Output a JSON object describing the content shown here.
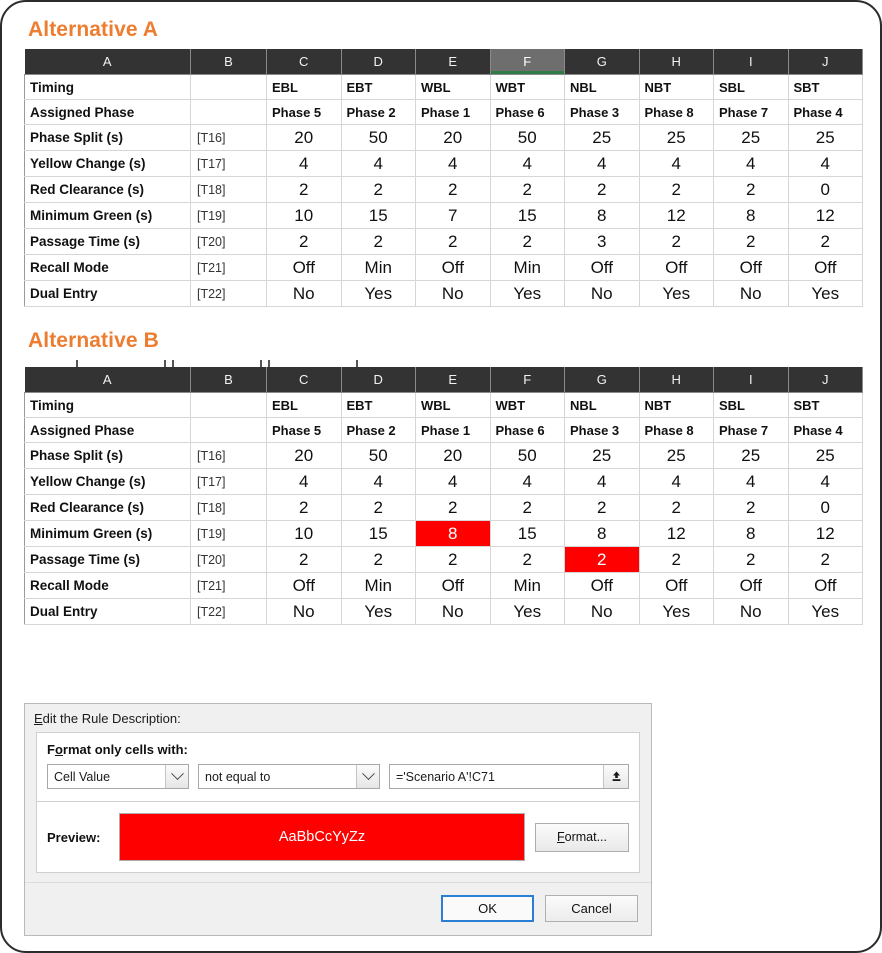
{
  "sections": [
    {
      "title": "Alternative A",
      "columns": [
        "A",
        "B",
        "C",
        "D",
        "E",
        "F",
        "G",
        "H",
        "I",
        "J"
      ],
      "active_column": "F",
      "has_tab_notches": false,
      "header_rows": [
        {
          "label": "Timing",
          "ref": "",
          "values": [
            "EBL",
            "EBT",
            "WBL",
            "WBT",
            "NBL",
            "NBT",
            "SBL",
            "SBT"
          ]
        },
        {
          "label": "Assigned Phase",
          "ref": "",
          "values": [
            "Phase 5",
            "Phase 2",
            "Phase 1",
            "Phase 6",
            "Phase 3",
            "Phase 8",
            "Phase 7",
            "Phase 4"
          ]
        }
      ],
      "rows": [
        {
          "label": "Phase Split (s)",
          "ref": "[T16]",
          "values": [
            "20",
            "50",
            "20",
            "50",
            "25",
            "25",
            "25",
            "25"
          ],
          "flags": [
            false,
            false,
            false,
            false,
            false,
            false,
            false,
            false
          ]
        },
        {
          "label": "Yellow Change (s)",
          "ref": "[T17]",
          "values": [
            "4",
            "4",
            "4",
            "4",
            "4",
            "4",
            "4",
            "4"
          ],
          "flags": [
            false,
            false,
            false,
            false,
            false,
            false,
            false,
            false
          ]
        },
        {
          "label": "Red Clearance (s)",
          "ref": "[T18]",
          "values": [
            "2",
            "2",
            "2",
            "2",
            "2",
            "2",
            "2",
            "0"
          ],
          "flags": [
            false,
            false,
            false,
            false,
            false,
            false,
            false,
            false
          ]
        },
        {
          "label": "Minimum Green (s)",
          "ref": "[T19]",
          "values": [
            "10",
            "15",
            "7",
            "15",
            "8",
            "12",
            "8",
            "12"
          ],
          "flags": [
            false,
            false,
            false,
            false,
            false,
            false,
            false,
            false
          ]
        },
        {
          "label": "Passage Time (s)",
          "ref": "[T20]",
          "values": [
            "2",
            "2",
            "2",
            "2",
            "3",
            "2",
            "2",
            "2"
          ],
          "flags": [
            false,
            false,
            false,
            false,
            false,
            false,
            false,
            false
          ]
        },
        {
          "label": "Recall Mode",
          "ref": "[T21]",
          "values": [
            "Off",
            "Min",
            "Off",
            "Min",
            "Off",
            "Off",
            "Off",
            "Off"
          ],
          "flags": [
            false,
            false,
            false,
            false,
            false,
            false,
            false,
            false
          ]
        },
        {
          "label": "Dual Entry",
          "ref": "[T22]",
          "values": [
            "No",
            "Yes",
            "No",
            "Yes",
            "No",
            "Yes",
            "No",
            "Yes"
          ],
          "flags": [
            false,
            false,
            false,
            false,
            false,
            false,
            false,
            false
          ]
        }
      ]
    },
    {
      "title": "Alternative B",
      "columns": [
        "A",
        "B",
        "C",
        "D",
        "E",
        "F",
        "G",
        "H",
        "I",
        "J"
      ],
      "active_column": "",
      "has_tab_notches": true,
      "header_rows": [
        {
          "label": "Timing",
          "ref": "",
          "values": [
            "EBL",
            "EBT",
            "WBL",
            "WBT",
            "NBL",
            "NBT",
            "SBL",
            "SBT"
          ]
        },
        {
          "label": "Assigned Phase",
          "ref": "",
          "values": [
            "Phase 5",
            "Phase 2",
            "Phase 1",
            "Phase 6",
            "Phase 3",
            "Phase 8",
            "Phase 7",
            "Phase 4"
          ]
        }
      ],
      "rows": [
        {
          "label": "Phase Split (s)",
          "ref": "[T16]",
          "values": [
            "20",
            "50",
            "20",
            "50",
            "25",
            "25",
            "25",
            "25"
          ],
          "flags": [
            false,
            false,
            false,
            false,
            false,
            false,
            false,
            false
          ]
        },
        {
          "label": "Yellow Change (s)",
          "ref": "[T17]",
          "values": [
            "4",
            "4",
            "4",
            "4",
            "4",
            "4",
            "4",
            "4"
          ],
          "flags": [
            false,
            false,
            false,
            false,
            false,
            false,
            false,
            false
          ]
        },
        {
          "label": "Red Clearance (s)",
          "ref": "[T18]",
          "values": [
            "2",
            "2",
            "2",
            "2",
            "2",
            "2",
            "2",
            "0"
          ],
          "flags": [
            false,
            false,
            false,
            false,
            false,
            false,
            false,
            false
          ]
        },
        {
          "label": "Minimum Green (s)",
          "ref": "[T19]",
          "values": [
            "10",
            "15",
            "8",
            "15",
            "8",
            "12",
            "8",
            "12"
          ],
          "flags": [
            false,
            false,
            true,
            false,
            false,
            false,
            false,
            false
          ]
        },
        {
          "label": "Passage Time (s)",
          "ref": "[T20]",
          "values": [
            "2",
            "2",
            "2",
            "2",
            "2",
            "2",
            "2",
            "2"
          ],
          "flags": [
            false,
            false,
            false,
            false,
            true,
            false,
            false,
            false
          ]
        },
        {
          "label": "Recall Mode",
          "ref": "[T21]",
          "values": [
            "Off",
            "Min",
            "Off",
            "Min",
            "Off",
            "Off",
            "Off",
            "Off"
          ],
          "flags": [
            false,
            false,
            false,
            false,
            false,
            false,
            false,
            false
          ]
        },
        {
          "label": "Dual Entry",
          "ref": "[T22]",
          "values": [
            "No",
            "Yes",
            "No",
            "Yes",
            "No",
            "Yes",
            "No",
            "Yes"
          ],
          "flags": [
            false,
            false,
            false,
            false,
            false,
            false,
            false,
            false
          ]
        }
      ]
    }
  ],
  "dialog": {
    "edit_rule_label": "Edit the Rule Description:",
    "edit_rule_accel": "E",
    "edit_rule_rest": "dit the Rule Description:",
    "format_only_accel": "o",
    "format_only_pre": "F",
    "format_only_rest": "rmat only cells with:",
    "format_only_label": "Format only cells with:",
    "condition_type": "Cell Value",
    "operator": "not equal to",
    "formula": "='Scenario A'!C71",
    "preview_label": "Preview:",
    "preview_sample": "AaBbCcYyZz",
    "preview_fill_color": "#FF0000",
    "preview_text_color": "#FFFFFF",
    "format_button": "Format...",
    "format_button_accel": "F",
    "format_button_rest": "ormat...",
    "ok_button": "OK",
    "cancel_button": "Cancel"
  },
  "theme": {
    "heading_color": "#ED7D31",
    "header_bg": "#333333",
    "active_header_bg": "#6E6E6E",
    "active_underline": "#2E7D46",
    "highlight_red": "#FF0000"
  }
}
